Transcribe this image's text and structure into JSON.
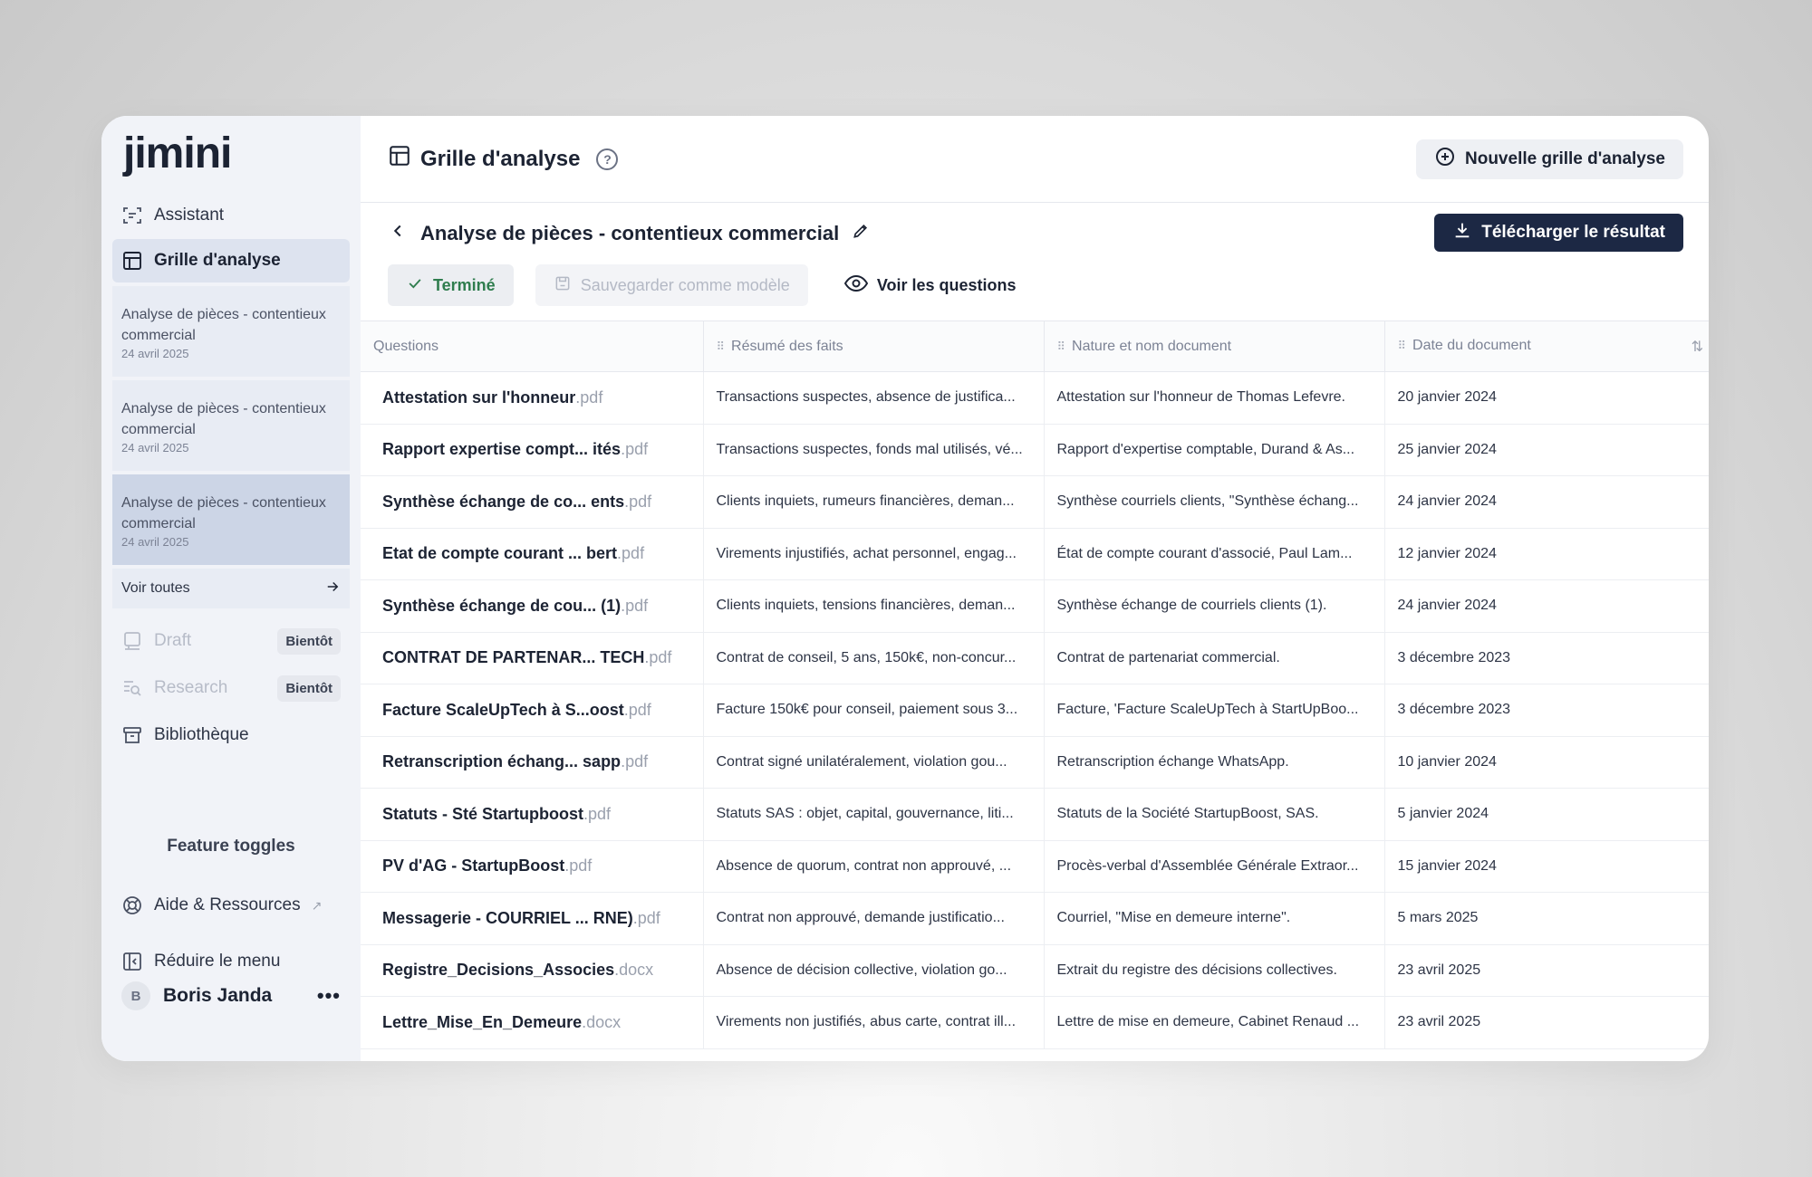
{
  "app": {
    "logo": "jimini"
  },
  "sidebar": {
    "assistant": "Assistant",
    "grille": "Grille d'analyse",
    "recent": [
      {
        "title": "Analyse de pièces - contentieux commercial",
        "date": "24 avril 2025"
      },
      {
        "title": "Analyse de pièces - contentieux commercial",
        "date": "24 avril 2025"
      },
      {
        "title": "Analyse de pièces - contentieux commercial",
        "date": "24 avril 2025"
      }
    ],
    "voir_toutes": "Voir toutes",
    "draft": "Draft",
    "research": "Research",
    "bientot": "Bientôt",
    "bibliotheque": "Bibliothèque",
    "feature_toggles": "Feature toggles",
    "aide": "Aide & Ressources",
    "reduire": "Réduire le menu",
    "user": {
      "initial": "B",
      "name": "Boris Janda"
    }
  },
  "header": {
    "title": "Grille d'analyse",
    "new_button": "Nouvelle grille d'analyse"
  },
  "analysis": {
    "title": "Analyse de pièces - contentieux commercial",
    "download": "Télécharger le résultat",
    "status": "Terminé",
    "save_template": "Sauvegarder comme modèle",
    "view_questions": "Voir les questions"
  },
  "table": {
    "columns": [
      "Questions",
      "Résumé des faits",
      "Nature et nom document",
      "Date du document"
    ],
    "rows": [
      {
        "name": "Attestation sur l'honneur",
        "ext": ".pdf",
        "resume": "Transactions suspectes, absence de justifica...",
        "nature": "Attestation sur l'honneur de Thomas Lefevre.",
        "date": "20 janvier 2024"
      },
      {
        "name": "Rapport expertise compt... ités",
        "ext": ".pdf",
        "resume": "Transactions suspectes, fonds mal utilisés, vé...",
        "nature": "Rapport d'expertise comptable, Durand & As...",
        "date": "25 janvier 2024"
      },
      {
        "name": "Synthèse échange de co... ents",
        "ext": ".pdf",
        "resume": "Clients inquiets, rumeurs financières, deman...",
        "nature": "Synthèse courriels clients, \"Synthèse échang...",
        "date": "24 janvier 2024"
      },
      {
        "name": "Etat de compte courant ... bert",
        "ext": ".pdf",
        "resume": "Virements injustifiés, achat personnel, engag...",
        "nature": "État de compte courant d'associé, Paul Lam...",
        "date": "12 janvier 2024"
      },
      {
        "name": "Synthèse échange de cou... (1)",
        "ext": ".pdf",
        "resume": "Clients inquiets, tensions financières, deman...",
        "nature": "Synthèse échange de courriels clients (1).",
        "date": "24 janvier 2024"
      },
      {
        "name": "CONTRAT DE PARTENAR... TECH",
        "ext": ".pdf",
        "resume": "Contrat de conseil, 5 ans, 150k€, non-concur...",
        "nature": "Contrat de partenariat commercial.",
        "date": "3 décembre 2023"
      },
      {
        "name": "Facture ScaleUpTech à S...oost",
        "ext": ".pdf",
        "resume": "Facture 150k€ pour conseil, paiement sous 3...",
        "nature": "Facture, 'Facture ScaleUpTech à StartUpBoo...",
        "date": "3 décembre 2023"
      },
      {
        "name": "Retranscription échang... sapp",
        "ext": ".pdf",
        "resume": "Contrat signé unilatéralement, violation gou...",
        "nature": "Retranscription échange WhatsApp.",
        "date": "10 janvier 2024"
      },
      {
        "name": "Statuts - Sté Startupboost",
        "ext": ".pdf",
        "resume": "Statuts SAS : objet, capital, gouvernance, liti...",
        "nature": "Statuts de la Société StartupBoost, SAS.",
        "date": "5 janvier 2024"
      },
      {
        "name": "PV d'AG - StartupBoost",
        "ext": ".pdf",
        "resume": "Absence de quorum, contrat non approuvé, ...",
        "nature": "Procès-verbal d'Assemblée Générale Extraor...",
        "date": "15 janvier 2024"
      },
      {
        "name": "Messagerie - COURRIEL ... RNE)",
        "ext": ".pdf",
        "resume": "Contrat non approuvé, demande justificatio...",
        "nature": "Courriel, \"Mise en demeure interne\".",
        "date": "5 mars 2025"
      },
      {
        "name": "Registre_Decisions_Associes",
        "ext": ".docx",
        "resume": "Absence de décision collective, violation go...",
        "nature": "Extrait du registre des décisions collectives.",
        "date": "23 avril 2025"
      },
      {
        "name": "Lettre_Mise_En_Demeure",
        "ext": ".docx",
        "resume": "Virements non justifiés, abus carte, contrat ill...",
        "nature": "Lettre de mise en demeure, Cabinet Renaud ...",
        "date": "23 avril 2025"
      }
    ]
  }
}
